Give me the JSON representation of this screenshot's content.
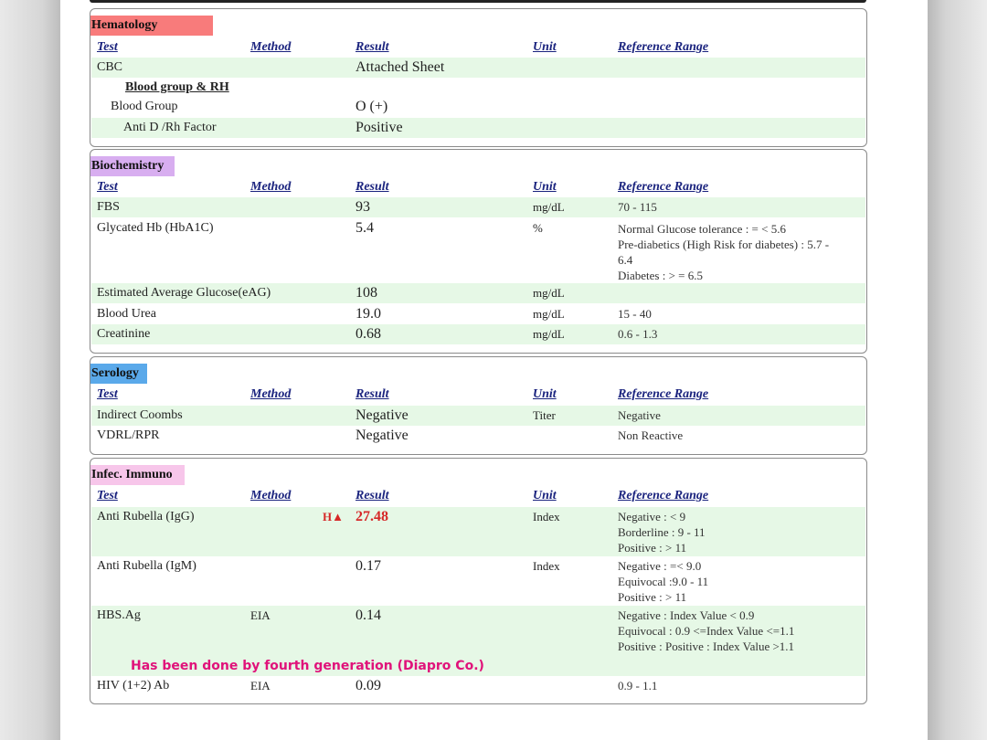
{
  "headers": {
    "test": "Test",
    "method": "Method",
    "result": "Result",
    "unit": "Unit",
    "ref": "Reference Range"
  },
  "hematology": {
    "title": "Hematology",
    "cbc": {
      "test": "CBC",
      "result": "Attached Sheet"
    },
    "subheading": "Blood group & RH",
    "blood_group": {
      "test": "Blood Group",
      "result": "O (+)"
    },
    "anti_d": {
      "test": "Anti D /Rh Factor",
      "result": "Positive"
    }
  },
  "biochemistry": {
    "title": "Biochemistry",
    "fbs": {
      "test": "FBS",
      "result": "93",
      "unit": "mg/dL",
      "ref": "70 - 115"
    },
    "hba1c": {
      "test": "Glycated Hb (HbA1C)",
      "result": "5.4",
      "unit": "%",
      "ref_lines": [
        "Normal Glucose tolerance : = < 5.6",
        "Pre-diabetics (High Risk for diabetes) : 5.7 -",
        "6.4",
        "Diabetes : > = 6.5"
      ]
    },
    "eag": {
      "test": "Estimated Average Glucose(eAG)",
      "result": "108",
      "unit": "mg/dL"
    },
    "urea": {
      "test": "Blood Urea",
      "result": "19.0",
      "unit": "mg/dL",
      "ref": "15 - 40"
    },
    "creatinine": {
      "test": "Creatinine",
      "result": "0.68",
      "unit": "mg/dL",
      "ref": "0.6 - 1.3"
    }
  },
  "serology": {
    "title": "Serology",
    "coombs": {
      "test": "Indirect Coombs",
      "result": "Negative",
      "unit": "Titer",
      "ref": "Negative"
    },
    "vdrl": {
      "test": "VDRL/RPR",
      "result": "Negative",
      "ref": "Non Reactive"
    }
  },
  "infec_immuno": {
    "title": "Infec. Immuno",
    "rubella_igg": {
      "test": "Anti  Rubella (IgG)",
      "flag": "H▲",
      "result": "27.48",
      "unit": "Index",
      "ref_lines": [
        "Negative : < 9",
        "Borderline : 9 - 11",
        "Positive  : > 11"
      ]
    },
    "rubella_igm": {
      "test": "Anti  Rubella (IgM)",
      "result": "0.17",
      "unit": "Index",
      "ref_lines": [
        "Negative : =< 9.0",
        "Equivocal :9.0 - 11",
        "Positive  : > 11"
      ]
    },
    "hbsag": {
      "test": "HBS.Ag",
      "method": "EIA",
      "result": "0.14",
      "ref_lines": [
        "Negative  :  Index Value < 0.9",
        "Equivocal :  0.9 <=Index Value <=1.1",
        "Positive   :  Positive :  Index Value >1.1"
      ]
    },
    "note": "Has been done by fourth generation (Diapro Co.)",
    "hiv": {
      "test": "HIV (1+2) Ab",
      "method": "EIA",
      "result": "0.09",
      "ref": "0.9 - 1.1"
    }
  },
  "colors": {
    "abnormal": "#d62828",
    "note": "#e0127a",
    "row_shade": "#e6f8e6",
    "header_text": "#1a237e"
  }
}
